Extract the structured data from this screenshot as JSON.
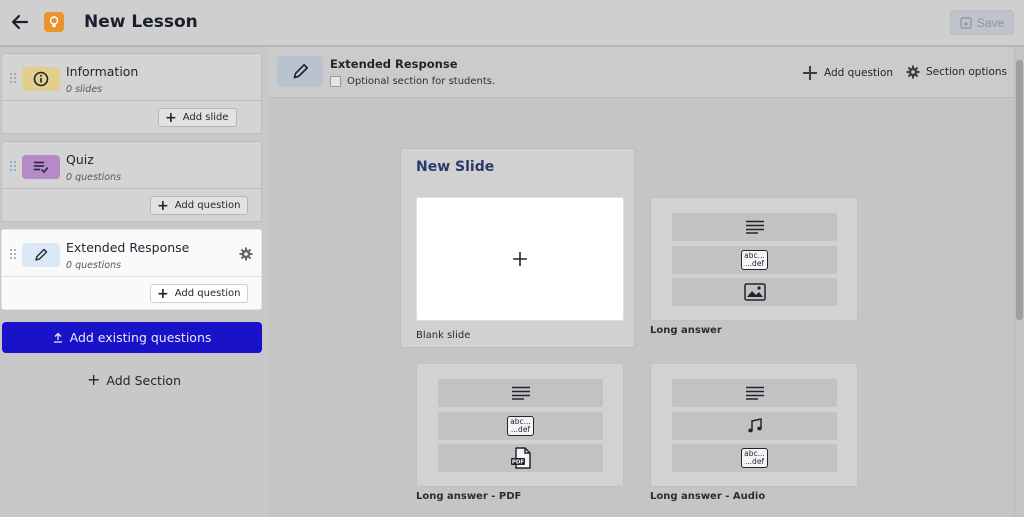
{
  "header": {
    "title": "New Lesson",
    "save_label": "Save"
  },
  "sidebar": {
    "sections": [
      {
        "title": "Information",
        "subtitle": "0 slides",
        "add_label": "Add slide",
        "icon": "info-icon",
        "icon_bg": "#e2cf8e"
      },
      {
        "title": "Quiz",
        "subtitle": "0 questions",
        "add_label": "Add question",
        "icon": "checklist-icon",
        "icon_bg": "#b48ac7"
      },
      {
        "title": "Extended Response",
        "subtitle": "0 questions",
        "add_label": "Add question",
        "icon": "pencil-icon",
        "icon_bg": "#dbe9f7"
      }
    ],
    "add_existing_label": "Add existing questions",
    "add_section_label": "Add Section"
  },
  "section_header": {
    "title": "Extended Response",
    "optional_label": "Optional section for students.",
    "add_question_label": "Add question",
    "section_options_label": "Section options"
  },
  "new_slide": {
    "title": "New Slide",
    "templates": [
      {
        "label": "Blank slide"
      },
      {
        "label": "Long answer"
      },
      {
        "label": "Long answer - PDF"
      },
      {
        "label": "Long answer - Audio"
      }
    ],
    "abc_text_top": "abc...",
    "abc_text_bottom": "...def",
    "pdf_text": "PDF"
  },
  "colors": {
    "primary_button": "#1a12c8",
    "lesson_icon": "#e8942a",
    "heading_blue": "#2b3a6e"
  }
}
